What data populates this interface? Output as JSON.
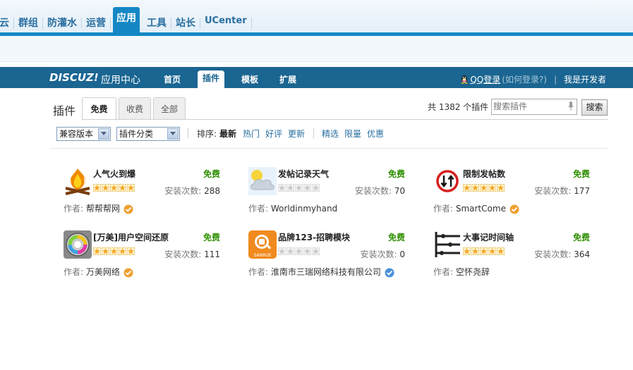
{
  "topnav": {
    "items": [
      "云",
      "群组",
      "防灌水",
      "运营",
      "应用",
      "工具",
      "站长",
      "UCenter"
    ],
    "active": "应用"
  },
  "app_header": {
    "logo": "DISCUZ!",
    "title": "应用中心",
    "nav": [
      "首页",
      "插件",
      "模板",
      "扩展"
    ],
    "active_nav": "插件",
    "qq_login": "QQ登录",
    "qq_hint": "(如何登录?)",
    "separator": "|",
    "developer": "我是开发者"
  },
  "plugins_section": {
    "title": "插件",
    "tabs": [
      "免费",
      "收费",
      "全部"
    ],
    "active_tab": "免费",
    "count_text": "共 1382 个插件",
    "search": {
      "placeholder": "搜索插件",
      "button": "搜索"
    }
  },
  "filters": {
    "version_select": "兼容版本",
    "category_select": "插件分类",
    "sort_label": "排序:",
    "sort_options": [
      "最新",
      "热门",
      "好评",
      "更新"
    ],
    "active_sort": "最新",
    "tags": [
      "精选",
      "限量",
      "优惠"
    ]
  },
  "plugins": [
    {
      "name": "人气火到爆",
      "price": "免费",
      "rating": 5,
      "install_label": "安装次数:",
      "installs": "288",
      "author_label": "作者:",
      "author": "帮帮帮网",
      "verified": "orange"
    },
    {
      "name": "发帖记录天气",
      "price": "免费",
      "rating": 0,
      "install_label": "安装次数:",
      "installs": "70",
      "author_label": "作者:",
      "author": "Worldinmyhand",
      "verified": ""
    },
    {
      "name": "限制发帖数",
      "price": "免费",
      "rating": 5,
      "install_label": "安装次数:",
      "installs": "177",
      "author_label": "作者:",
      "author": "SmartCome",
      "verified": "orange"
    },
    {
      "name": "[万美]用户空间还原",
      "price": "免费",
      "rating": 5,
      "install_label": "安装次数:",
      "installs": "111",
      "author_label": "作者:",
      "author": "万美网络",
      "verified": "orange"
    },
    {
      "name": "品牌123-招聘模块",
      "price": "免费",
      "rating": 0,
      "install_label": "安装次数:",
      "installs": "0",
      "author_label": "作者:",
      "author": "淮南市三瑞网络科技有限公司",
      "verified": "blue",
      "icon_text": "SANRUE"
    },
    {
      "name": "大事记时间轴",
      "price": "免费",
      "rating": 5,
      "install_label": "安装次数:",
      "installs": "364",
      "author_label": "作者:",
      "author": "空怀尧辞",
      "verified": ""
    }
  ],
  "colors": {
    "brand_blue": "#1a6591",
    "nav_blue": "#1587c4",
    "free_green": "#2d8f00",
    "link_blue": "#2a6fa0"
  }
}
